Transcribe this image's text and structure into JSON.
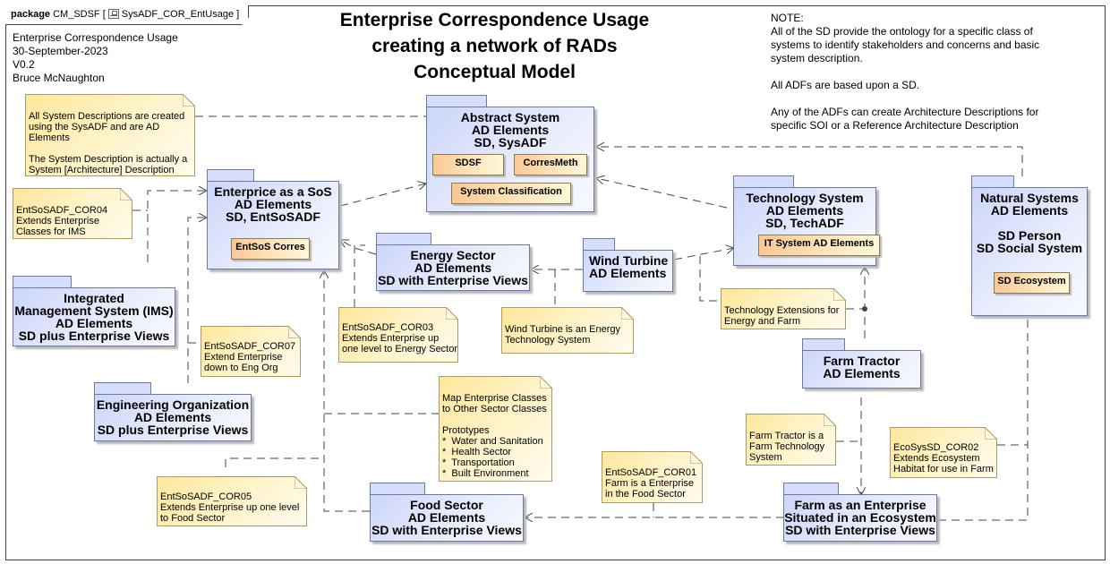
{
  "frame": {
    "kind": "package",
    "name": "CM_SDSF",
    "diagram_icon": "class-diagram-icon",
    "diagram_name": "SysADF_COR_EntUsage"
  },
  "meta": {
    "text": "Enterprise Correspondence Usage\n30-September-2023\nV0.2\nBruce McNaughton"
  },
  "title": {
    "text": "Enterprise Correspondence Usage\ncreating a network of RADs\nConceptual Model"
  },
  "top_note": {
    "text": "NOTE:\nAll of the SD provide the ontology for a specific class of\nsystems to identify stakeholders and concerns and basic\nsystem description.\n\nAll ADFs are based upon a SD.\n\nAny of the ADFs can create Architecture Descriptions for\nspecific SOI or a Reference Architecture Description"
  },
  "packages": {
    "abstract_system": {
      "label": "Abstract System\nAD Elements\nSD, SysADF",
      "classes": [
        "SDSF",
        "CorresMeth",
        "System Classification"
      ]
    },
    "enterprise_sos": {
      "label": "Enterprice as a SoS\nAD Elements\nSD, EntSoSADF",
      "classes": [
        "EntSoS Corres"
      ]
    },
    "technology_system": {
      "label": "Technology System\nAD Elements\nSD, TechADF",
      "classes": [
        "IT System AD Elements"
      ]
    },
    "natural_systems": {
      "label": "Natural Systems\nAD Elements\n\nSD Person\nSD Social System",
      "classes": [
        "SD Ecosystem"
      ]
    },
    "energy_sector": {
      "label": "Energy Sector\nAD Elements\nSD with Enterprise Views"
    },
    "wind_turbine": {
      "label": "Wind Turbine\nAD Elements"
    },
    "ims": {
      "label": "Integrated\nManagement System (IMS)\nAD Elements\nSD plus Enterprise Views"
    },
    "engineering_org": {
      "label": "Engineering Organization\nAD Elements\nSD plus Enterprise Views"
    },
    "farm_tractor": {
      "label": "Farm Tractor\nAD Elements"
    },
    "food_sector": {
      "label": "Food Sector\nAD Elements\nSD with Enterprise Views"
    },
    "farm_enterprise": {
      "label": "Farm as an Enterprise\nSituated in an Ecosystem\nSD with Enterprise Views"
    }
  },
  "notes": {
    "system_descriptions": "All System Descriptions are created\nusing the SysADF and are AD\nElements\n\nThe System Description is actually a\nSystem [Architecture] Description",
    "cor04": "EntSoSADF_COR04\nExtends Enterprise\nClasses for IMS",
    "cor07": "EntSoSADF_COR07\nExtend Enterprise\ndown to Eng Org",
    "cor03": "EntSoSADF_COR03\nExtends Enterprise up\none level to Energy Sector",
    "wind_turbine_note": "Wind Turbine is an Energy\nTechnology System",
    "tech_extensions": "Technology Extensions for\nEnergy and Farm",
    "map_classes": "Map Enterprise Classes\nto Other Sector Classes\n\nPrototypes\n*  Water and Sanitation\n*  Health Sector\n*  Transportation\n*  Built Environment",
    "cor05": "EntSoSADF_COR05\nExtends Enterprise up one level\nto Food Sector",
    "cor01": "EntSoSADF_COR01\nFarm is a Enterprise\nin the Food Sector",
    "farm_tractor_note": "Farm Tractor is a\nFarm Technology\nSystem",
    "eco_cor02": "EcoSysSD_COR02\nExtends Ecosystem\nHabitat for use in Farm"
  },
  "colors": {
    "package_fill": "#d6defc",
    "package_border": "#6b7aa0",
    "class_fill": "#fbc796",
    "note_fill": "#fde79b",
    "line": "#444444"
  }
}
